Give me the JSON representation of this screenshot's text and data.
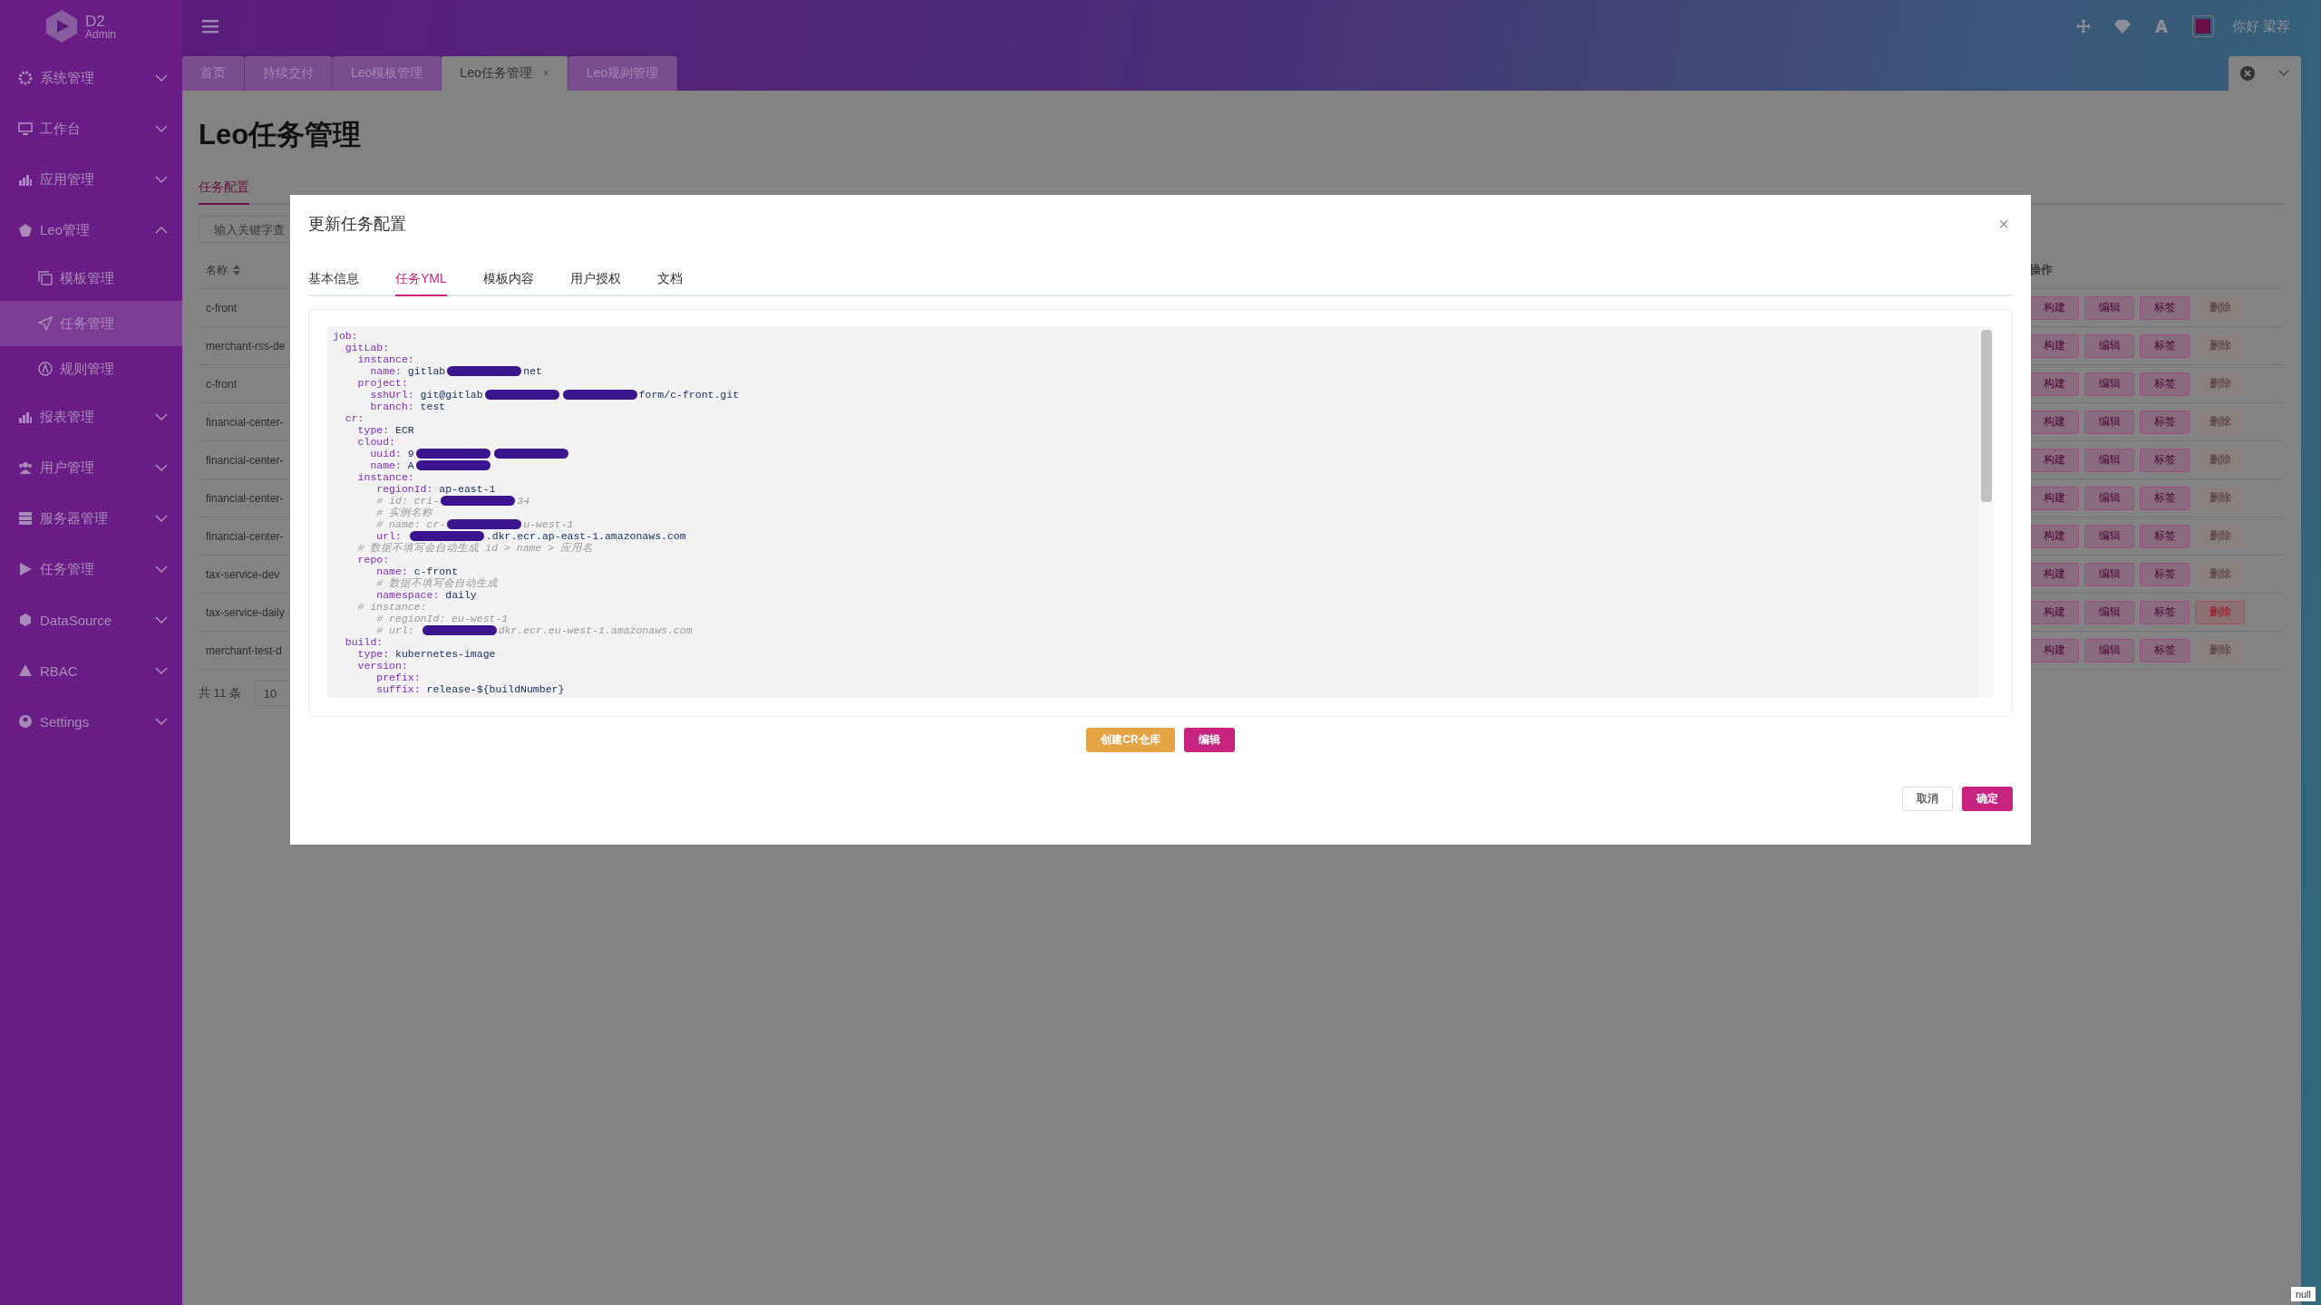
{
  "header": {
    "logo_title": "D2",
    "logo_subtitle": "Admin",
    "greeting": "你好 梁荐"
  },
  "sidebar": {
    "items": [
      {
        "label": "系统管理",
        "expanded": false
      },
      {
        "label": "工作台",
        "expanded": false
      },
      {
        "label": "应用管理",
        "expanded": false
      },
      {
        "label": "Leo管理",
        "expanded": true,
        "children": [
          {
            "label": "模板管理",
            "selected": false
          },
          {
            "label": "任务管理",
            "selected": true
          },
          {
            "label": "规则管理",
            "selected": false
          }
        ]
      },
      {
        "label": "报表管理",
        "expanded": false
      },
      {
        "label": "用户管理",
        "expanded": false
      },
      {
        "label": "服务器管理",
        "expanded": false
      },
      {
        "label": "任务管理",
        "expanded": false
      },
      {
        "label": "DataSource",
        "expanded": false
      },
      {
        "label": "RBAC",
        "expanded": false
      },
      {
        "label": "Settings",
        "expanded": false
      }
    ]
  },
  "page_tabs": [
    {
      "label": "首页",
      "selected": false
    },
    {
      "label": "持续交付",
      "selected": false
    },
    {
      "label": "Leo模板管理",
      "selected": false
    },
    {
      "label": "Leo任务管理",
      "selected": true,
      "close": "×"
    },
    {
      "label": "Leo规则管理",
      "selected": false
    }
  ],
  "page": {
    "title": "Leo任务管理",
    "subtabs": [
      {
        "label": "任务配置",
        "selected": true
      }
    ],
    "search": {
      "placeholder": "输入关键字查"
    },
    "name_column": "名称",
    "action_column": "操作",
    "rows": [
      {
        "name": "c-front",
        "actions": [
          "构建",
          "编辑",
          "标签",
          "删除"
        ],
        "delete_disabled": true
      },
      {
        "name": "merchant-rss-de",
        "actions": [
          "构建",
          "编辑",
          "标签",
          "删除"
        ],
        "delete_disabled": true
      },
      {
        "name": "c-front",
        "actions": [
          "构建",
          "编辑",
          "标签",
          "删除"
        ],
        "delete_disabled": true
      },
      {
        "name": "financial-center-",
        "actions": [
          "构建",
          "编辑",
          "标签",
          "删除"
        ],
        "delete_disabled": true
      },
      {
        "name": "financial-center-",
        "actions": [
          "构建",
          "编辑",
          "标签",
          "删除"
        ],
        "delete_disabled": true
      },
      {
        "name": "financial-center-",
        "actions": [
          "构建",
          "编辑",
          "标签",
          "删除"
        ],
        "delete_disabled": true
      },
      {
        "name": "financial-center-",
        "actions": [
          "构建",
          "编辑",
          "标签",
          "删除"
        ],
        "delete_disabled": true
      },
      {
        "name": "tax-service-dev",
        "actions": [
          "构建",
          "编辑",
          "标签",
          "删除"
        ],
        "delete_disabled": true
      },
      {
        "name": "tax-service-daily",
        "actions": [
          "构建",
          "编辑",
          "标签",
          "删除"
        ],
        "delete_disabled": false
      },
      {
        "name": "merchant-test-d",
        "actions": [
          "构建",
          "编辑",
          "标签",
          "删除"
        ],
        "delete_disabled": true
      }
    ],
    "total": "共 11 条",
    "page_size": "10"
  },
  "modal": {
    "title": "更新任务配置",
    "close": "×",
    "tabs": [
      {
        "label": "基本信息",
        "selected": false
      },
      {
        "label": "任务YML",
        "selected": true
      },
      {
        "label": "模板内容",
        "selected": false
      },
      {
        "label": "用户授权",
        "selected": false
      },
      {
        "label": "文档",
        "selected": false
      }
    ],
    "code": [
      [
        {
          "kind": "key",
          "text": "job:"
        }
      ],
      [
        {
          "kind": "key",
          "text": "  gitLab:"
        }
      ],
      [
        {
          "kind": "key",
          "text": "    instance:"
        }
      ],
      [
        {
          "kind": "key",
          "text": "      name:"
        },
        {
          "kind": "value",
          "text": " gitlab"
        },
        {
          "kind": "redacted"
        },
        {
          "kind": "value",
          "text": "net"
        }
      ],
      [
        {
          "kind": "key",
          "text": "    project:"
        }
      ],
      [
        {
          "kind": "key",
          "text": "      sshUrl:"
        },
        {
          "kind": "value",
          "text": " git@gitlab"
        },
        {
          "kind": "redacted"
        },
        {
          "kind": "redacted"
        },
        {
          "kind": "value",
          "text": "form/c-front.git"
        }
      ],
      [
        {
          "kind": "key",
          "text": "      branch:"
        },
        {
          "kind": "value",
          "text": " test"
        }
      ],
      [
        {
          "kind": "key",
          "text": "  cr:"
        }
      ],
      [
        {
          "kind": "key",
          "text": "    type:"
        },
        {
          "kind": "value",
          "text": " ECR"
        }
      ],
      [
        {
          "kind": "key",
          "text": "    cloud:"
        }
      ],
      [
        {
          "kind": "key",
          "text": "      uuid:"
        },
        {
          "kind": "value",
          "text": " 9"
        },
        {
          "kind": "redacted"
        },
        {
          "kind": "redacted"
        }
      ],
      [
        {
          "kind": "key",
          "text": "      name:"
        },
        {
          "kind": "value",
          "text": " A"
        },
        {
          "kind": "redacted"
        }
      ],
      [
        {
          "kind": "key",
          "text": "    instance:"
        }
      ],
      [
        {
          "kind": "key",
          "text": "       regionId:"
        },
        {
          "kind": "value",
          "text": " ap-east-1"
        }
      ],
      [
        {
          "kind": "comment",
          "text": "       # id: cri-"
        },
        {
          "kind": "redacted"
        },
        {
          "kind": "comment",
          "text": "34"
        }
      ],
      [
        {
          "kind": "comment",
          "text": "       # 实例名称"
        }
      ],
      [
        {
          "kind": "comment",
          "text": "       # name: cr-"
        },
        {
          "kind": "redacted"
        },
        {
          "kind": "comment",
          "text": "u-west-1"
        }
      ],
      [
        {
          "kind": "key",
          "text": "       url: "
        },
        {
          "kind": "redacted"
        },
        {
          "kind": "value",
          "text": ".dkr.ecr.ap-east-1.amazonaws.com"
        }
      ],
      [
        {
          "kind": "comment",
          "text": "    # 数据不填写会自动生成 id > name > 应用名"
        }
      ],
      [
        {
          "kind": "key",
          "text": "    repo:"
        }
      ],
      [
        {
          "kind": "key",
          "text": "       name:"
        },
        {
          "kind": "value",
          "text": " c-front"
        }
      ],
      [
        {
          "kind": "comment",
          "text": "       # 数据不填写会自动生成"
        }
      ],
      [
        {
          "kind": "key",
          "text": "       namespace:"
        },
        {
          "kind": "value",
          "text": " daily"
        }
      ],
      [
        {
          "kind": "comment",
          "text": "    # instance:"
        }
      ],
      [
        {
          "kind": "comment",
          "text": "       # regionId: eu-west-1"
        }
      ],
      [
        {
          "kind": "comment",
          "text": "       # url: "
        },
        {
          "kind": "redacted"
        },
        {
          "kind": "comment",
          "text": "dkr.ecr.eu-west-1.amazonaws.com"
        }
      ],
      [
        {
          "kind": "key",
          "text": "  build:"
        }
      ],
      [
        {
          "kind": "key",
          "text": "    type:"
        },
        {
          "kind": "value",
          "text": " kubernetes-image"
        }
      ],
      [
        {
          "kind": "key",
          "text": "    version:"
        }
      ],
      [
        {
          "kind": "key",
          "text": "       prefix:"
        }
      ],
      [
        {
          "kind": "key",
          "text": "       suffix:"
        },
        {
          "kind": "value",
          "text": " release-${buildNumber}"
        }
      ]
    ],
    "buttons": [
      {
        "label": "创建CR仓库",
        "kind": "warning"
      },
      {
        "label": "编辑",
        "kind": "primary"
      }
    ],
    "footer": [
      {
        "label": "取消",
        "kind": "default"
      },
      {
        "label": "确定",
        "kind": "primary"
      }
    ]
  },
  "corner_tag": "null"
}
